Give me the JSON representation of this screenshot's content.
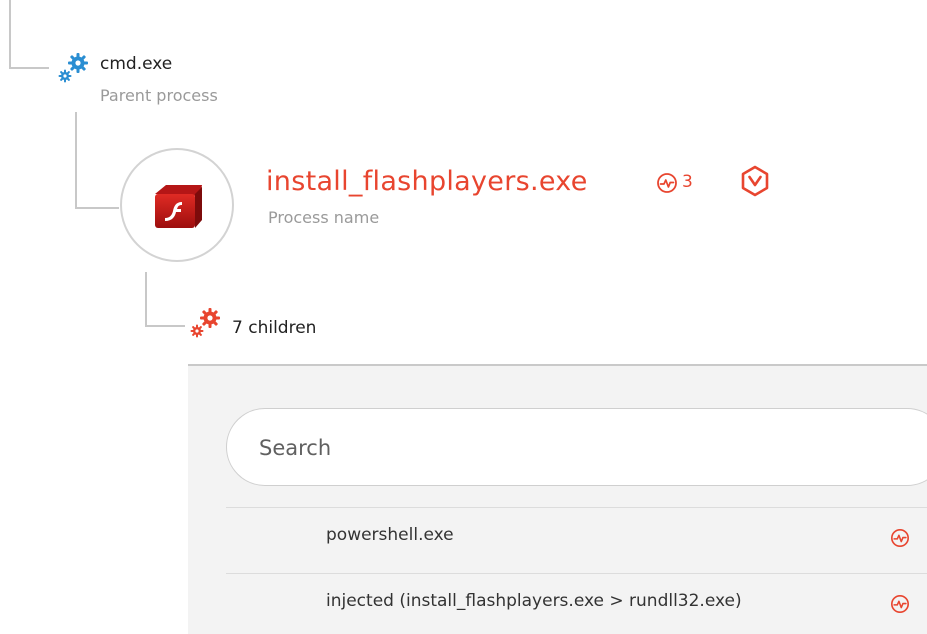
{
  "parent": {
    "name": "cmd.exe",
    "subtitle": "Parent process",
    "icon": "gears-icon"
  },
  "process": {
    "name": "install_flashplayers.exe",
    "subtitle": "Process name",
    "alert_count": "3",
    "icon": "flash-player-icon",
    "alert_icon": "alert-pulse-icon",
    "threat_icon": "hexagon-threat-icon"
  },
  "children": {
    "label": "7 children",
    "search": {
      "placeholder": "Search",
      "value": ""
    },
    "items": [
      {
        "label": "powershell.exe",
        "status_icon": "alert-pulse-icon"
      },
      {
        "label": "injected (install_flashplayers.exe > rundll32.exe)",
        "status_icon": "alert-pulse-icon"
      }
    ]
  },
  "colors": {
    "accent": "#e8452f",
    "gear_blue": "#2a8ed2",
    "line": "#c8c8c8",
    "muted": "#9a9a9a",
    "panel_bg": "#f3f3f3"
  }
}
